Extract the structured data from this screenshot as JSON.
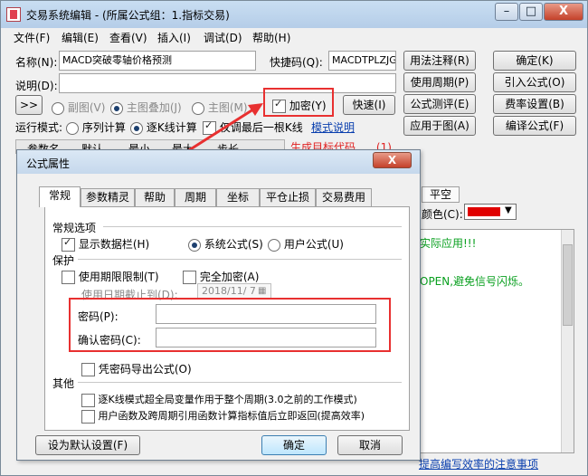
{
  "window": {
    "title": "交易系统编辑 - (所属公式组：1.指标交易)",
    "controls": {
      "minimize": "–",
      "maximize": "□",
      "close": "X"
    }
  },
  "menu": [
    "文件(F)",
    "编辑(E)",
    "查看(V)",
    "插入(I)",
    "调试(D)",
    "帮助(H)"
  ],
  "form": {
    "name_label": "名称(N):",
    "name_value": "MACD突破零轴价格预测",
    "shortcut_label": "快捷码(Q):",
    "shortcut_value": "MACDTPLZJGYC",
    "desc_label": "说明(D):",
    "expand_btn": ">>",
    "sub_chart": "副图(V)",
    "main_overlay": "主图叠加(J)",
    "main_chart": "主图(M)",
    "encrypt": "加密(Y)",
    "quick_btn": "快速(I)",
    "run_mode_label": "运行模式:",
    "seq_calc": "序列计算",
    "tick_calc": "逐K线计算",
    "last_bar_only": "仅调最后一根K线",
    "mode_help": "模式说明",
    "red_hint": "生成目标代码......(1)",
    "param_header": [
      "参数名",
      "默认",
      "最小",
      "最大",
      "步长"
    ],
    "color_label": "颜色(C):",
    "tab_short": "平空",
    "editor_text_1": "实际应用!!!",
    "editor_text_2": "OPEN,避免信号闪烁。",
    "footer_link": "提高编写效率的注意事项"
  },
  "right_buttons": [
    "用法注释(R)",
    "确定(K)",
    "使用周期(P)",
    "引入公式(O)",
    "公式测评(E)",
    "费率设置(B)",
    "应用于图(A)",
    "编译公式(F)"
  ],
  "dialog": {
    "title": "公式属性",
    "close": "X",
    "tabs": [
      "常规",
      "参数精灵",
      "帮助",
      "周期",
      "坐标",
      "平仓止损",
      "交易费用"
    ],
    "group_general": "常规选项",
    "show_databar": "显示数据栏(H)",
    "system_formula": "系统公式(S)",
    "user_formula": "用户公式(U)",
    "group_protect": "保护",
    "use_period_limit": "使用期限限制(T)",
    "full_encrypt": "完全加密(A)",
    "expire_label": "使用日期截止到(D):",
    "expire_value": "2018/11/ 7",
    "password_label": "密码(P):",
    "confirm_password_label": "确认密码(C):",
    "export_with_password": "凭密码导出公式(O)",
    "group_other": "其他",
    "other_opt_1": "逐K线模式超全局变量作用于整个周期(3.0之前的工作模式)",
    "other_opt_2": "用户函数及跨周期引用函数计算指标值后立即返回(提高效率)",
    "set_default_btn": "设为默认设置(F)",
    "ok_btn": "确定",
    "cancel_btn": "取消"
  }
}
